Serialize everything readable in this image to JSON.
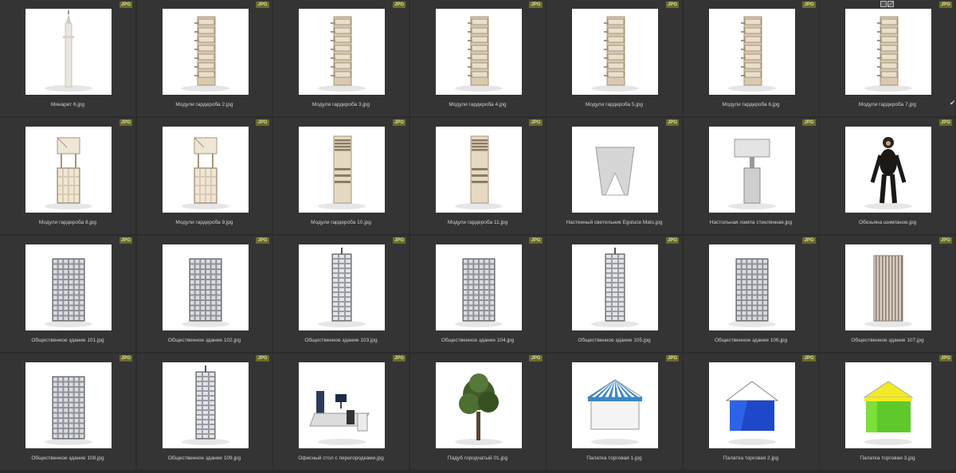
{
  "badge_text": "JPG",
  "items": [
    {
      "filename": "Минарет 6.jpg",
      "icon": "minaret"
    },
    {
      "filename": "Модули гардероба 2.jpg",
      "icon": "wardrobe"
    },
    {
      "filename": "Модули гардероба 3.jpg",
      "icon": "wardrobe"
    },
    {
      "filename": "Модули гардероба 4.jpg",
      "icon": "wardrobe"
    },
    {
      "filename": "Модули гардероба 5.jpg",
      "icon": "wardrobe"
    },
    {
      "filename": "Модули гардероба 6.jpg",
      "icon": "wardrobe"
    },
    {
      "filename": "Модули гардероба 7.jpg",
      "icon": "wardrobe"
    },
    {
      "filename": "Модули гардероба 8.jpg",
      "icon": "wardrobe-cubbies"
    },
    {
      "filename": "Модули гардероба 9.jpg",
      "icon": "wardrobe-cubbies"
    },
    {
      "filename": "Модули гардероба 10.jpg",
      "icon": "wardrobe-shelves"
    },
    {
      "filename": "Модули гардероба 11.jpg",
      "icon": "wardrobe-shelves"
    },
    {
      "filename": "Настенный светильник Egoluce Mats.jpg",
      "icon": "wall-lamp"
    },
    {
      "filename": "Настольная лампа стеклянная.jpg",
      "icon": "table-lamp"
    },
    {
      "filename": "Обезьяна шимпанзе.jpg",
      "icon": "chimpanzee"
    },
    {
      "filename": "Общественное здание 101.jpg",
      "icon": "building"
    },
    {
      "filename": "Общественное здание 102.jpg",
      "icon": "building"
    },
    {
      "filename": "Общественное здание 103.jpg",
      "icon": "tower"
    },
    {
      "filename": "Общественное здание 104.jpg",
      "icon": "building"
    },
    {
      "filename": "Общественное здание 105.jpg",
      "icon": "tower"
    },
    {
      "filename": "Общественное здание 106.jpg",
      "icon": "building"
    },
    {
      "filename": "Общественное здание 107.jpg",
      "icon": "building-striped"
    },
    {
      "filename": "Общественное здание 108.jpg",
      "icon": "building"
    },
    {
      "filename": "Общественное здание 109.jpg",
      "icon": "tower"
    },
    {
      "filename": "Офисный стол с перегородками.jpg",
      "icon": "office-desk"
    },
    {
      "filename": "Падуб городчатый 01.jpg",
      "icon": "tree"
    },
    {
      "filename": "Палатка торговая 1.jpg",
      "icon": "tent-striped"
    },
    {
      "filename": "Палатка торговая 2.jpg",
      "icon": "tent-blue"
    },
    {
      "filename": "Палатка торговая 3.jpg",
      "icon": "tent-green"
    }
  ],
  "colors": {
    "background": "#2b2b2b",
    "tile": "#343434",
    "badge_bg": "#6b6b2c",
    "badge_text": "#dede9a",
    "label": "#d0d0d0"
  }
}
